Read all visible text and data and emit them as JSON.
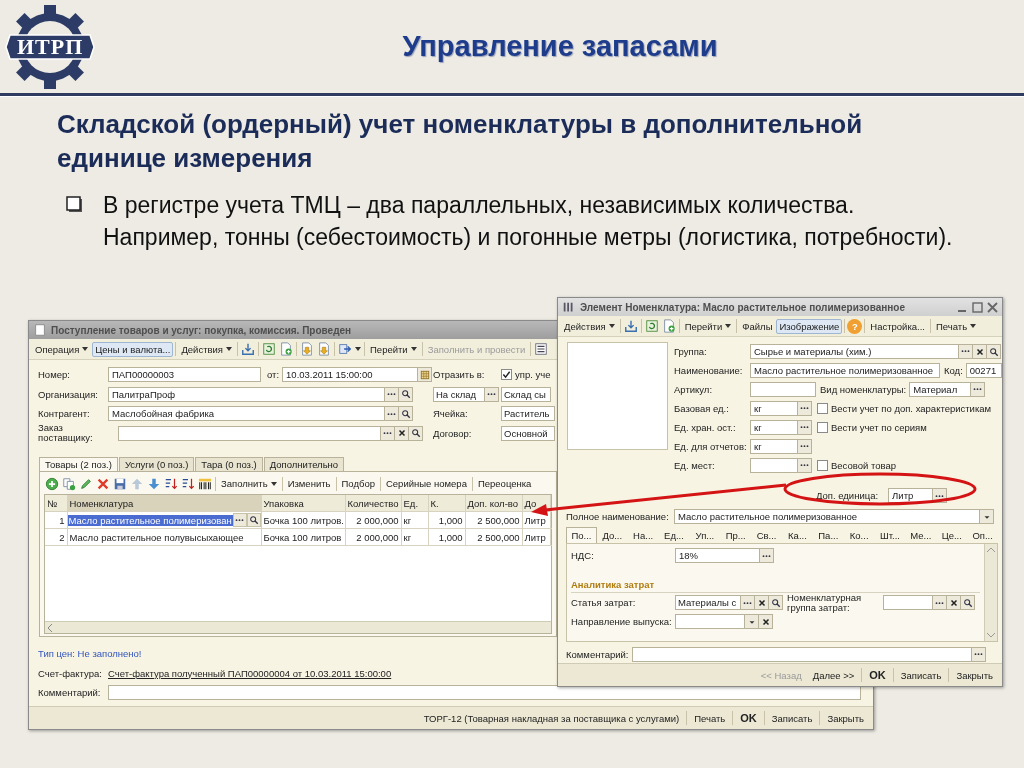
{
  "slide": {
    "logo_text": "ИТРП",
    "title": "Управление запасами",
    "subtitle": "Складской (ордерный) учет номенклатуры в дополнительной единице измерения",
    "bullets": [
      "В регистре учета ТМЦ – два параллельных, независимых количества. Например, тонны (себестоимость) и погонные метры (логистика, потребности)."
    ]
  },
  "receipt_window": {
    "title": "Поступление товаров и услуг: покупка, комиссия. Проведен",
    "toolbar": [
      {
        "kind": "menu",
        "label": "Операция"
      },
      {
        "kind": "button",
        "label": "Цены и валюта...",
        "pressed": true,
        "disabled": false
      },
      {
        "kind": "separator"
      },
      {
        "kind": "menu",
        "label": "Действия"
      },
      {
        "kind": "separator"
      },
      {
        "kind": "icon"
      },
      {
        "kind": "separator"
      },
      {
        "kind": "icon"
      },
      {
        "kind": "icon"
      },
      {
        "kind": "separator"
      },
      {
        "kind": "icon"
      },
      {
        "kind": "icon"
      },
      {
        "kind": "separator"
      },
      {
        "kind": "icon-menu"
      },
      {
        "kind": "separator"
      },
      {
        "kind": "menu",
        "label": "Перейти"
      },
      {
        "kind": "separator"
      },
      {
        "kind": "button",
        "label": "Заполнить и провести",
        "pressed": false,
        "disabled": true
      },
      {
        "kind": "separator"
      },
      {
        "kind": "icon"
      }
    ],
    "number": {
      "label": "Номер:",
      "value": "ПАП00000003"
    },
    "date": {
      "label": "от:",
      "value": "10.03.2011 15:00:00",
      "buttons": [
        {
          "kind": "calendar"
        }
      ]
    },
    "fields": [
      {
        "label": "Организация:",
        "value": "ПалитраПроф",
        "buttons": [
          {
            "kind": "select"
          },
          {
            "kind": "search"
          }
        ]
      },
      {
        "label": "Контрагент:",
        "value": "Маслобойная фабрика",
        "buttons": [
          {
            "kind": "select"
          },
          {
            "kind": "search"
          }
        ]
      },
      {
        "label": "Заказ поставщику:",
        "buttons": [
          {
            "kind": "select"
          },
          {
            "kind": "clear"
          },
          {
            "kind": "search"
          }
        ]
      }
    ],
    "reflect": {
      "label": "Отразить в:",
      "checked": true,
      "text": "упр. уче"
    },
    "warehouse_type": {
      "value": "На склад",
      "buttons": [
        {
          "kind": "select"
        }
      ]
    },
    "warehouse": {
      "value": "Склад сы"
    },
    "side_fields": [
      {
        "label": "Ячейка:",
        "value": "Раститель"
      },
      {
        "label": "Договор:",
        "value": "Основной"
      }
    ],
    "tabs": [
      {
        "label": "Товары (2 поз.)",
        "selected": true
      },
      {
        "label": "Услуги (0 поз.)",
        "selected": false
      },
      {
        "label": "Тара (0 поз.)",
        "selected": false
      },
      {
        "label": "Дополнительно",
        "selected": false
      }
    ],
    "table_toolbar": [
      {
        "kind": "icon"
      },
      {
        "kind": "icon"
      },
      {
        "kind": "icon"
      },
      {
        "kind": "icon"
      },
      {
        "kind": "icon"
      },
      {
        "kind": "icon"
      },
      {
        "kind": "icon"
      },
      {
        "kind": "icon"
      },
      {
        "kind": "icon"
      },
      {
        "kind": "icon"
      },
      {
        "kind": "separator"
      },
      {
        "kind": "menu",
        "label": "Заполнить"
      },
      {
        "kind": "separator"
      },
      {
        "kind": "button",
        "label": "Изменить",
        "pressed": false,
        "disabled": false
      },
      {
        "kind": "separator"
      },
      {
        "kind": "button",
        "label": "Подбор",
        "pressed": false,
        "disabled": false
      },
      {
        "kind": "separator"
      },
      {
        "kind": "button",
        "label": "Серийные номера",
        "pressed": false,
        "disabled": false
      },
      {
        "kind": "separator"
      },
      {
        "kind": "button",
        "label": "Переоценка",
        "pressed": false,
        "disabled": false
      }
    ],
    "table": {
      "columns": [
        {
          "label": "№",
          "selected": false
        },
        {
          "label": "Номенклатура",
          "selected": true
        },
        {
          "label": "Упаковка",
          "selected": false
        },
        {
          "label": "Количество",
          "selected": false
        },
        {
          "label": "Ед.",
          "selected": false
        },
        {
          "label": "К.",
          "selected": false
        },
        {
          "label": "Доп. кол-во",
          "selected": false
        },
        {
          "label": "До",
          "selected": false
        }
      ],
      "rows": [
        {
          "selected": true,
          "cells": [
            "1",
            "Масло растительное полимеризован",
            "Бочка 100 литров.",
            "2 000,000",
            "кг",
            "1,000",
            "2 500,000",
            "Литр"
          ]
        },
        {
          "selected": false,
          "cells": [
            "2",
            "Масло растительное полувысыхающее",
            "Бочка 100 литров",
            "2 000,000",
            "кг",
            "1,000",
            "2 500,000",
            "Литр"
          ]
        }
      ]
    },
    "price_type_link": "Тип цен: Не заполнено!",
    "invoice": {
      "label": "Счет-фактура:",
      "link": "Счет-фактура полученный ПАП00000004 от 10.03.2011 15:00:00"
    },
    "comment": {
      "label": "Комментарий:"
    },
    "footer": [
      {
        "kind": "link",
        "label": "ТОРГ-12 (Товарная накладная за поставщика с услугами)",
        "disabled": false
      },
      {
        "kind": "button",
        "label": "Печать",
        "disabled": false
      },
      {
        "kind": "default",
        "label": "OK",
        "disabled": false
      },
      {
        "kind": "button",
        "label": "Записать",
        "disabled": false
      },
      {
        "kind": "button",
        "label": "Закрыть",
        "disabled": false
      }
    ]
  },
  "item_window": {
    "title": "Элемент Номенклатура: Масло растительное полимеризованное",
    "toolbar": [
      {
        "kind": "menu",
        "label": "Действия"
      },
      {
        "kind": "separator"
      },
      {
        "kind": "icon"
      },
      {
        "kind": "separator"
      },
      {
        "kind": "icon"
      },
      {
        "kind": "icon"
      },
      {
        "kind": "separator"
      },
      {
        "kind": "menu",
        "label": "Перейти"
      },
      {
        "kind": "separator"
      },
      {
        "kind": "button",
        "label": "Файлы",
        "pressed": false,
        "disabled": false
      },
      {
        "kind": "button",
        "label": "Изображение",
        "pressed": true,
        "disabled": false
      },
      {
        "kind": "separator"
      },
      {
        "kind": "help",
        "label": "?"
      },
      {
        "kind": "separator"
      },
      {
        "kind": "button",
        "label": "Настройка...",
        "pressed": false,
        "disabled": false
      },
      {
        "kind": "separator"
      },
      {
        "kind": "menu",
        "label": "Печать"
      }
    ],
    "fields": [
      {
        "kind": "wide",
        "label": "Группа:",
        "value": "Сырье и материалы (хим.)",
        "buttons": [
          {
            "kind": "select"
          },
          {
            "kind": "clear"
          },
          {
            "kind": "search"
          }
        ]
      },
      {
        "kind": "name",
        "label": "Наименование:",
        "value": "Масло растительное полимеризованное",
        "extra": {
          "label": "Код:",
          "value": "00271"
        }
      },
      {
        "kind": "article",
        "label": "Артикул:",
        "extra": {
          "label": "Вид номенклатуры:",
          "value": "Материал",
          "buttons": [
            {
              "kind": "select"
            }
          ]
        }
      },
      {
        "kind": "unit",
        "label": "Базовая ед.:",
        "value": "кг",
        "buttons": [
          {
            "kind": "select"
          }
        ],
        "option": {
          "label": "Вести учет по доп.  характеристикам",
          "checked": false
        }
      },
      {
        "kind": "unit",
        "label": "Ед. хран. ост.:",
        "value": "кг",
        "buttons": [
          {
            "kind": "select"
          }
        ],
        "option": {
          "label": "Вести учет по сериям",
          "checked": false
        }
      },
      {
        "kind": "unit",
        "label": "Ед. для отчетов:",
        "value": "кг",
        "buttons": [
          {
            "kind": "select"
          }
        ]
      },
      {
        "kind": "unit",
        "label": "Ед. мест:",
        "buttons": [
          {
            "kind": "select"
          }
        ],
        "option": {
          "label": "Весовой товар",
          "checked": false
        }
      }
    ],
    "extra_unit": {
      "label": "Доп. единица:",
      "value": "Литр",
      "buttons": [
        {
          "kind": "select"
        }
      ],
      "highlighted": true
    },
    "full_name": {
      "label": "Полное наименование:",
      "value": "Масло растительное полимеризованное",
      "buttons": [
        {
          "kind": "dropdown"
        }
      ]
    },
    "tabs": [
      {
        "label": "По...",
        "selected": true
      },
      {
        "label": "До...",
        "selected": false
      },
      {
        "label": "На...",
        "selected": false
      },
      {
        "label": "Ед...",
        "selected": false
      },
      {
        "label": "Уп...",
        "selected": false
      },
      {
        "label": "Пр...",
        "selected": false
      },
      {
        "label": "Св...",
        "selected": false
      },
      {
        "label": "Ка...",
        "selected": false
      },
      {
        "label": "Па...",
        "selected": false
      },
      {
        "label": "Ко...",
        "selected": false
      },
      {
        "label": "Шт...",
        "selected": false
      },
      {
        "label": "Ме...",
        "selected": false
      },
      {
        "label": "Це...",
        "selected": false
      },
      {
        "label": "Оп...",
        "selected": false
      }
    ],
    "vat": {
      "label": "НДС:",
      "value": "18%",
      "buttons": [
        {
          "kind": "select"
        }
      ]
    },
    "section_title": "Аналитика затрат",
    "cost_item": {
      "label": "Статья затрат:",
      "value": "Материалы с",
      "buttons": [
        {
          "kind": "select"
        },
        {
          "kind": "clear"
        },
        {
          "kind": "search"
        }
      ]
    },
    "cost_group": {
      "label": "Номенклатурная группа затрат:",
      "buttons": [
        {
          "kind": "select"
        },
        {
          "kind": "clear"
        },
        {
          "kind": "search"
        }
      ]
    },
    "output_direction": {
      "label": "Направление выпуска:",
      "buttons": [
        {
          "kind": "dropdown"
        },
        {
          "kind": "clear"
        }
      ]
    },
    "comment": {
      "label": "Комментарий:",
      "buttons": [
        {
          "kind": "select"
        }
      ]
    },
    "footer": [
      {
        "kind": "nav",
        "label": "<< Назад",
        "disabled": true
      },
      {
        "kind": "nav",
        "label": "Далее >>",
        "disabled": false
      },
      {
        "kind": "default",
        "label": "OK",
        "disabled": false
      },
      {
        "kind": "button",
        "label": "Записать",
        "disabled": false
      },
      {
        "kind": "button",
        "label": "Закрыть",
        "disabled": false
      }
    ]
  }
}
